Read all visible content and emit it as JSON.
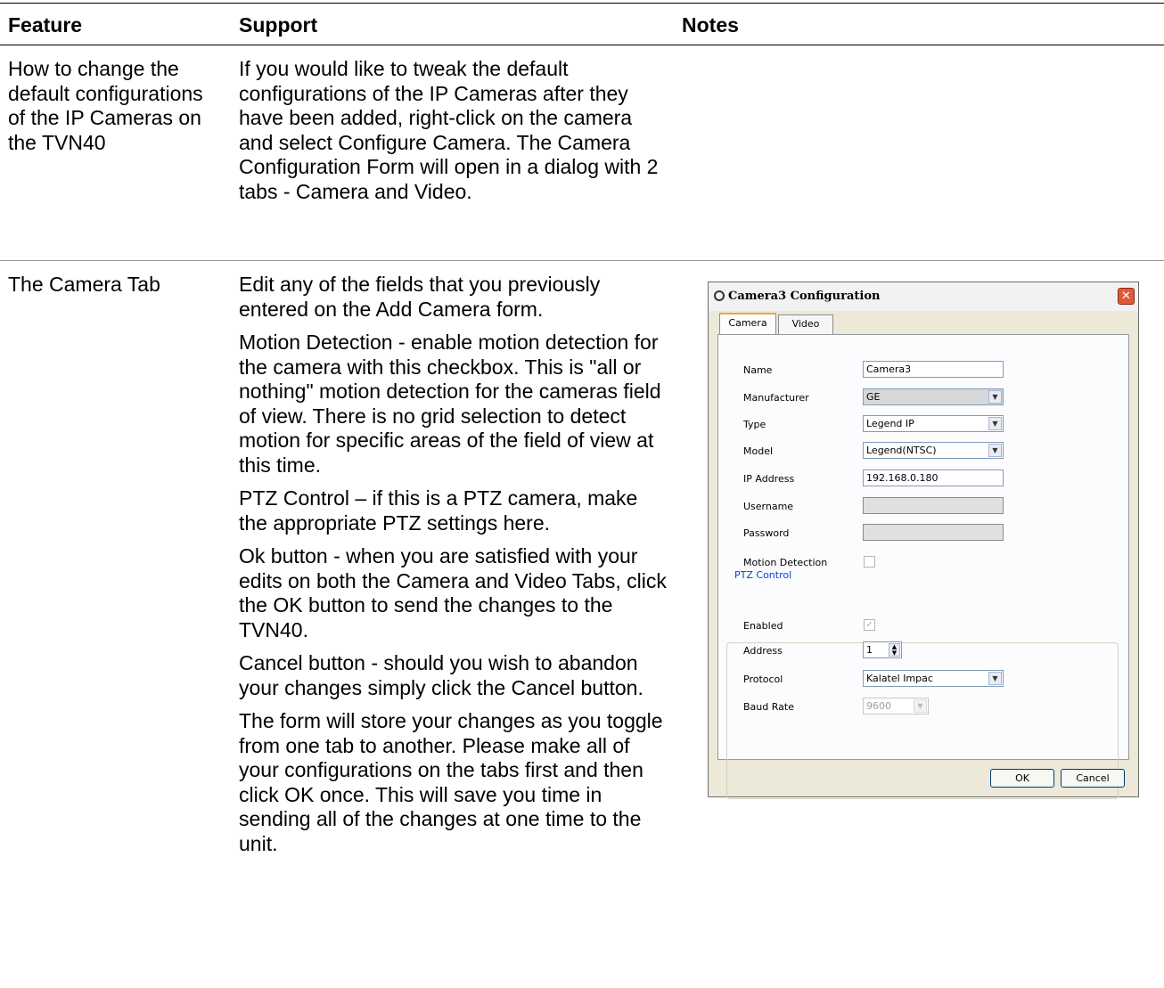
{
  "table": {
    "headers": {
      "feature": "Feature",
      "support": "Support",
      "notes": "Notes"
    },
    "rows": [
      {
        "feature": "How to change the default configurations of the IP Cameras on the TVN40",
        "support": [
          "If you would like to tweak the default configurations of the IP Cameras after they have been added, right-click on the camera and select Configure Camera. The Camera Configuration Form will open in a dialog with 2 tabs - Camera and Video."
        ]
      },
      {
        "feature": "The Camera Tab",
        "support": [
          "Edit any of the fields that you previously entered on the Add Camera form.",
          "Motion Detection - enable motion detection for the camera with this checkbox. This is \"all or nothing\" motion detection for the cameras field of view. There is no grid selection to detect motion for specific areas of the field of view at this time.",
          "PTZ Control – if this is a PTZ camera, make the appropriate PTZ settings here.",
          "Ok button - when you are satisfied with your edits on both the Camera and Video Tabs, click the OK button to send the changes to the TVN40.",
          "Cancel button - should you wish to abandon your changes simply click the Cancel button.",
          "The form will store your changes as you toggle from one tab to another. Please make all of your configurations on the tabs first and then click OK once. This will save you time in sending all of the changes at one time to the unit."
        ]
      }
    ]
  },
  "dialog": {
    "title": "Camera3 Configuration",
    "close_glyph": "✕",
    "tabs": [
      "Camera",
      "Video"
    ],
    "active_tab": "Camera",
    "fields": {
      "name_label": "Name",
      "name_value": "Camera3",
      "manufacturer_label": "Manufacturer",
      "manufacturer_value": "GE",
      "type_label": "Type",
      "type_value": "Legend IP",
      "model_label": "Model",
      "model_value": "Legend(NTSC)",
      "ip_label": "IP Address",
      "ip_value": "192.168.0.180",
      "username_label": "Username",
      "username_value": "",
      "password_label": "Password",
      "password_value": "",
      "motion_label": "Motion Detection",
      "motion_checked": false
    },
    "ptz": {
      "group_label": "PTZ Control",
      "enabled_label": "Enabled",
      "enabled_checked": true,
      "address_label": "Address",
      "address_value": "1",
      "protocol_label": "Protocol",
      "protocol_value": "Kalatel Impac",
      "baud_label": "Baud Rate",
      "baud_value": "9600"
    },
    "buttons": {
      "ok": "OK",
      "cancel": "Cancel"
    },
    "glyphs": {
      "dropdown": "▼",
      "check": "✓",
      "spin_up": "▲",
      "spin_down": "▼"
    }
  }
}
